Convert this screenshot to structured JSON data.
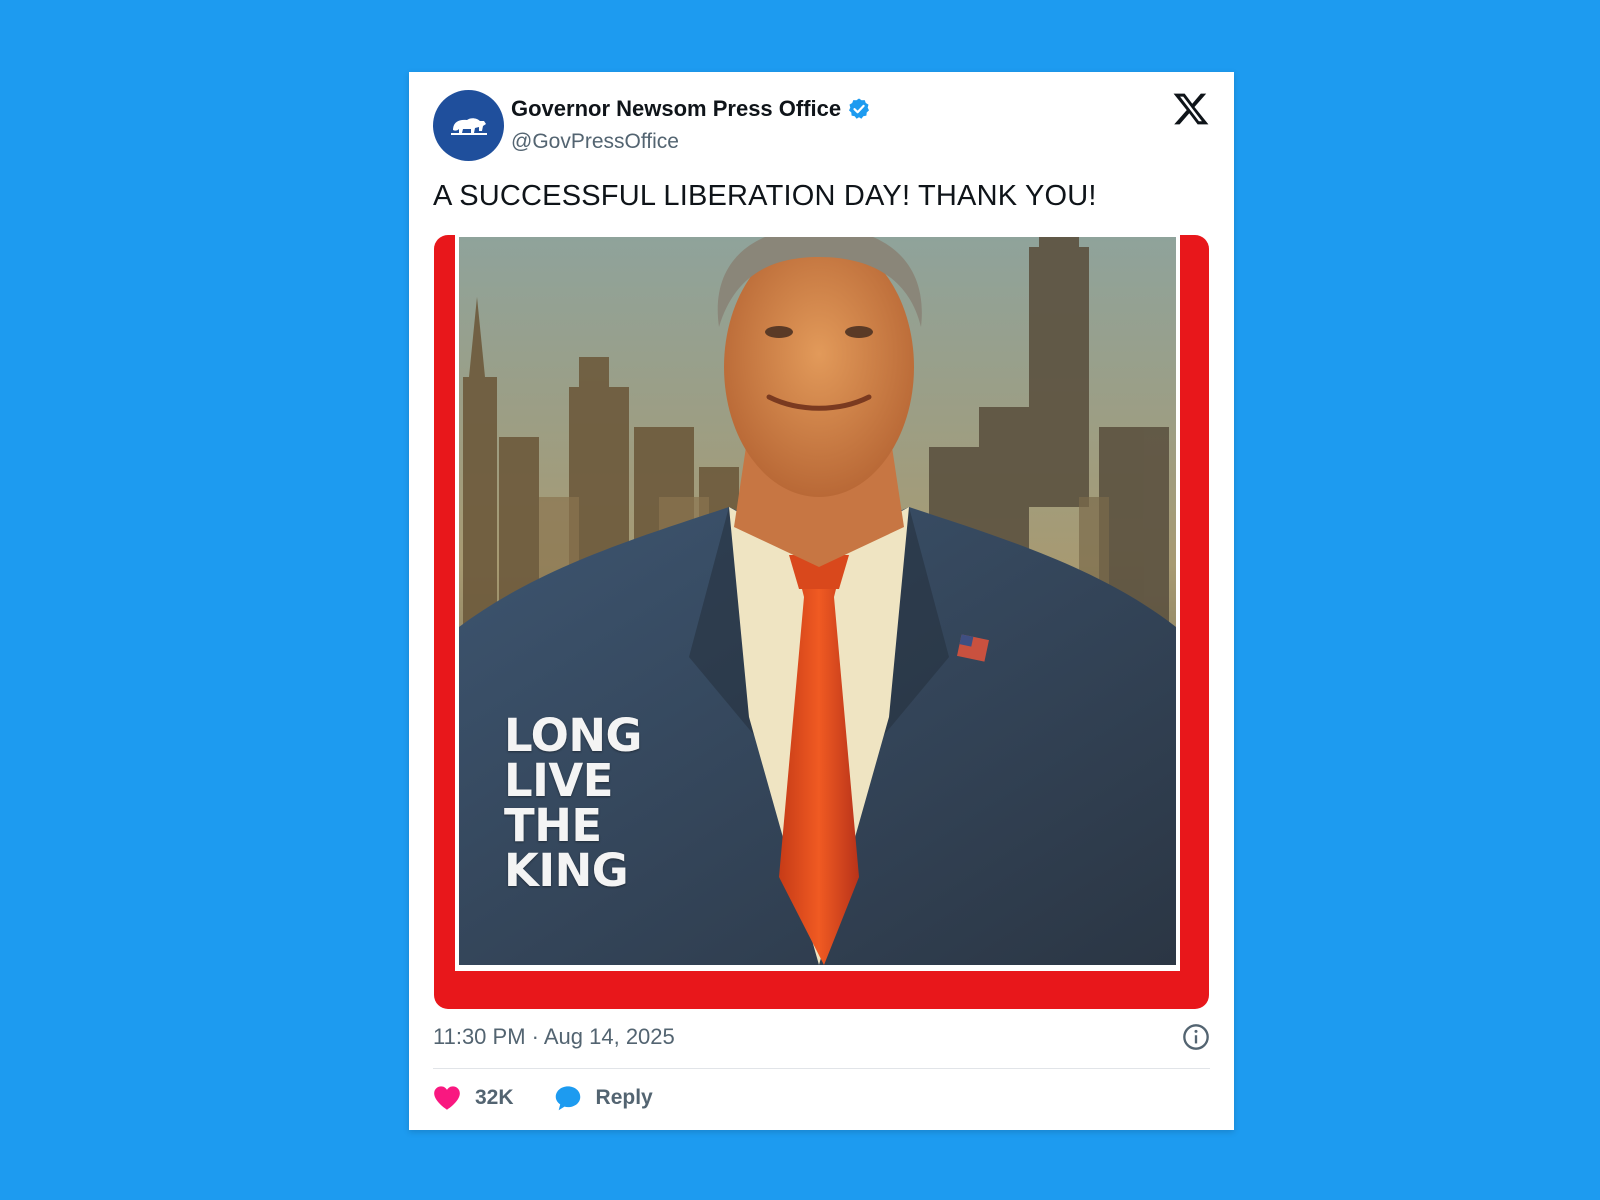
{
  "tweet": {
    "author_name": "Governor Newsom Press Office",
    "handle": "@GovPressOffice",
    "text": "A SUCCESSFUL LIBERATION DAY! THANK YOU!",
    "timestamp": "11:30 PM · Aug 14, 2025",
    "verified": true,
    "avatar_icon": "california-bear-icon"
  },
  "media": {
    "cover_lines": [
      "LONG",
      "LIVE",
      "THE",
      "KING"
    ],
    "frame_color": "#e8171b",
    "description_icon": "portrait-painting"
  },
  "actions": {
    "like_count": "32K",
    "reply_label": "Reply"
  },
  "colors": {
    "background": "#1d9bf0",
    "verified_badge": "#1d9bf0",
    "like_heart": "#f91880",
    "reply_bubble": "#1d9bf0"
  }
}
